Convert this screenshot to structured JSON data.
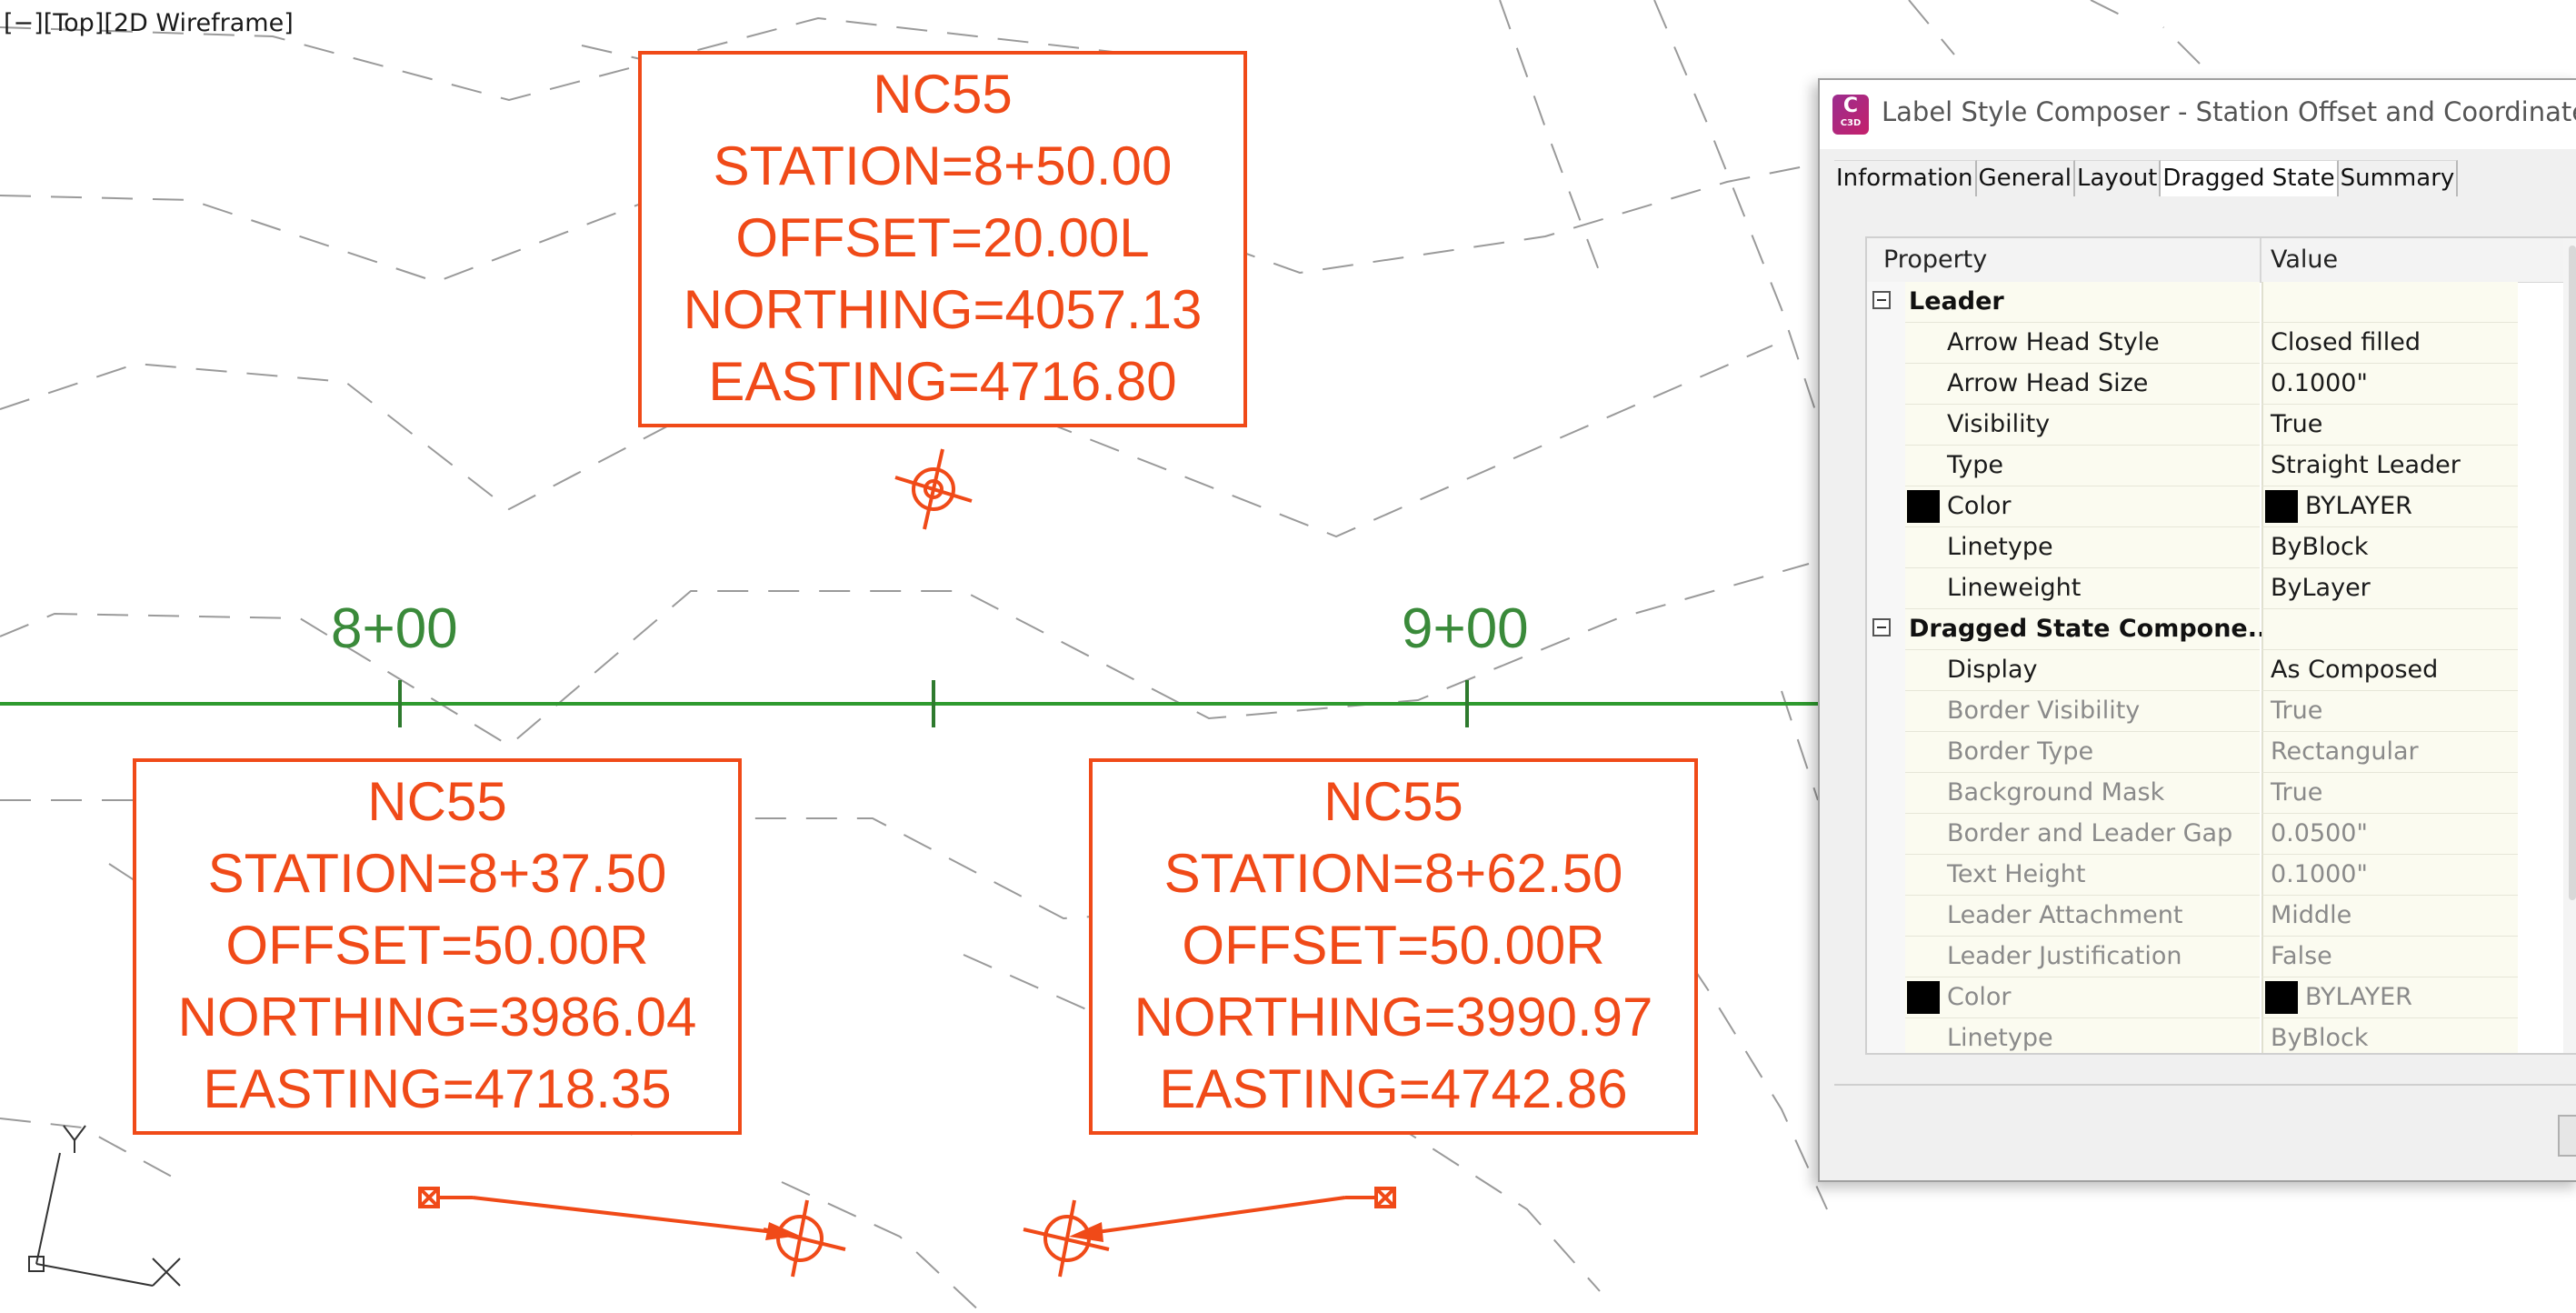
{
  "viewport": {
    "label_parts": [
      "[−]",
      "[Top]",
      "[2D Wireframe]"
    ],
    "accent_label_color": "#f04a18",
    "alignment_color": "#2e9a2e",
    "station_text_color": "#3a8a3a",
    "ucs_icon": {
      "y_label": "Y",
      "x_label": "X"
    }
  },
  "station_labels": [
    "8+00",
    "9+00"
  ],
  "labels": [
    {
      "lines": [
        "NC55",
        "STATION=8+50.00",
        "OFFSET=20.00L",
        "NORTHING=4057.13",
        "EASTING=4716.80"
      ]
    },
    {
      "lines": [
        "NC55",
        "STATION=8+37.50",
        "OFFSET=50.00R",
        "NORTHING=3986.04",
        "EASTING=4718.35"
      ]
    },
    {
      "lines": [
        "NC55",
        "STATION=8+62.50",
        "OFFSET=50.00R",
        "NORTHING=3990.97",
        "EASTING=4742.86"
      ]
    }
  ],
  "dialog": {
    "icon_text": "C",
    "icon_subtext": "C3D",
    "title": "Label Style Composer - Station Offset and Coordinates",
    "tabs": [
      "Information",
      "General",
      "Layout",
      "Dragged State",
      "Summary"
    ],
    "active_tab": "Dragged State",
    "grid": {
      "header_property": "Property",
      "header_value": "Value",
      "rows": [
        {
          "kind": "category",
          "property": "Leader",
          "value": ""
        },
        {
          "kind": "prop",
          "property": "Arrow Head Style",
          "value": "Closed filled"
        },
        {
          "kind": "prop",
          "property": "Arrow Head Size",
          "value": "0.1000\""
        },
        {
          "kind": "prop",
          "property": "Visibility",
          "value": "True"
        },
        {
          "kind": "prop",
          "property": "Type",
          "value": "Straight Leader"
        },
        {
          "kind": "color",
          "property": "Color",
          "value": "BYLAYER"
        },
        {
          "kind": "prop",
          "property": "Linetype",
          "value": "ByBlock"
        },
        {
          "kind": "prop",
          "property": "Lineweight",
          "value": "ByLayer"
        },
        {
          "kind": "category",
          "property": "Dragged State Compone...",
          "value": ""
        },
        {
          "kind": "prop",
          "property": "Display",
          "value": "As Composed"
        },
        {
          "kind": "disabled",
          "property": "Border Visibility",
          "value": "True"
        },
        {
          "kind": "disabled",
          "property": "Border Type",
          "value": "Rectangular"
        },
        {
          "kind": "disabled",
          "property": "Background Mask",
          "value": "True"
        },
        {
          "kind": "disabled",
          "property": "Border and Leader Gap",
          "value": "0.0500\""
        },
        {
          "kind": "disabled",
          "property": "Text Height",
          "value": "0.1000\""
        },
        {
          "kind": "disabled",
          "property": "Leader Attachment",
          "value": "Middle"
        },
        {
          "kind": "disabled",
          "property": "Leader Justification",
          "value": "False"
        },
        {
          "kind": "color-disabled",
          "property": "Color",
          "value": "BYLAYER"
        },
        {
          "kind": "disabled",
          "property": "Linetype",
          "value": "ByBlock"
        }
      ]
    }
  }
}
